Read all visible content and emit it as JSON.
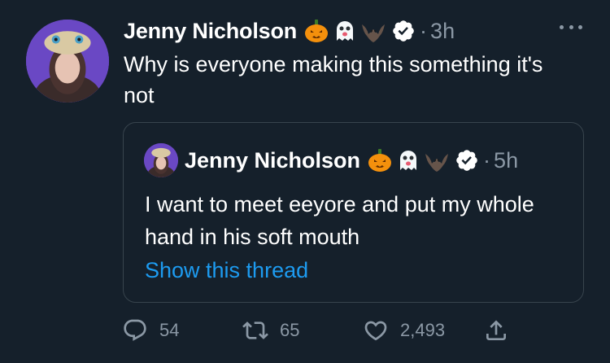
{
  "tweet": {
    "author_name": "Jenny Nicholson",
    "name_emojis": [
      "jack-o-lantern",
      "ghost",
      "bat"
    ],
    "verified": true,
    "separator": "·",
    "time": "3h",
    "text": "Why is everyone making this something it's not"
  },
  "quoted_tweet": {
    "author_name": "Jenny Nicholson",
    "name_emojis": [
      "jack-o-lantern",
      "ghost",
      "bat"
    ],
    "verified": true,
    "separator": "·",
    "time": "5h",
    "text": "I want to meet eeyore and put my whole hand in his soft mouth",
    "show_thread_label": "Show this thread"
  },
  "actions": {
    "reply_count": "54",
    "retweet_count": "65",
    "like_count": "2,493"
  },
  "colors": {
    "background": "#15202b",
    "text_primary": "#ffffff",
    "text_secondary": "#8b98a5",
    "link": "#1d9bf0",
    "border": "#38444d",
    "verified_badge": "#ffffff"
  }
}
